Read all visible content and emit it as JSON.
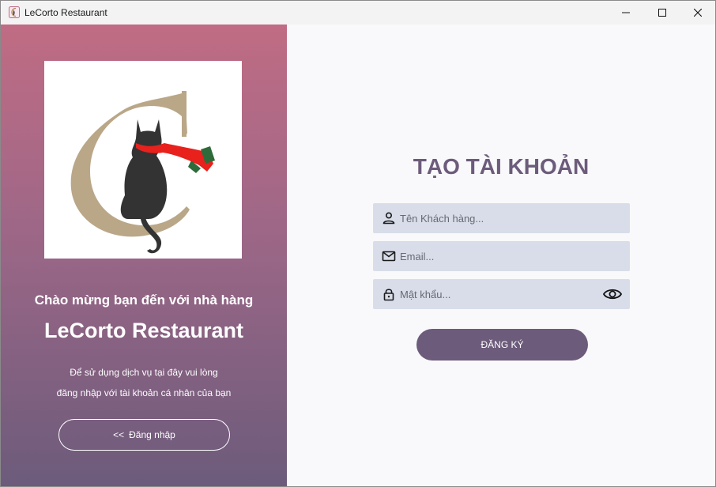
{
  "window": {
    "title": "LeCorto Restaurant",
    "controls": [
      "minimize",
      "maximize",
      "close"
    ]
  },
  "left_panel": {
    "welcome_line1": "Chào mừng bạn đến với nhà hàng",
    "welcome_line2": "LeCorto Restaurant",
    "desc_line1": "Để sử dụng dịch vụ tại đây vui lòng",
    "desc_line2": "đăng nhập với tài khoản cá nhân của bạn",
    "login_button": {
      "arrows": "<<",
      "label": "Đăng nhập"
    },
    "gradient_colors": [
      "#c06c84",
      "#6c5b7b"
    ]
  },
  "form": {
    "title": "TẠO TÀI KHOẢN",
    "fields": {
      "name_placeholder": "Tên Khách hàng...",
      "email_placeholder": "Email...",
      "password_placeholder": "Mật khẩu..."
    },
    "register_button": "ĐĂNG KÝ",
    "accent_color": "#6c5b7b",
    "field_bg_color": "#d8dde9"
  },
  "icons": [
    "user-icon",
    "mail-icon",
    "lock-icon",
    "eye-icon"
  ]
}
